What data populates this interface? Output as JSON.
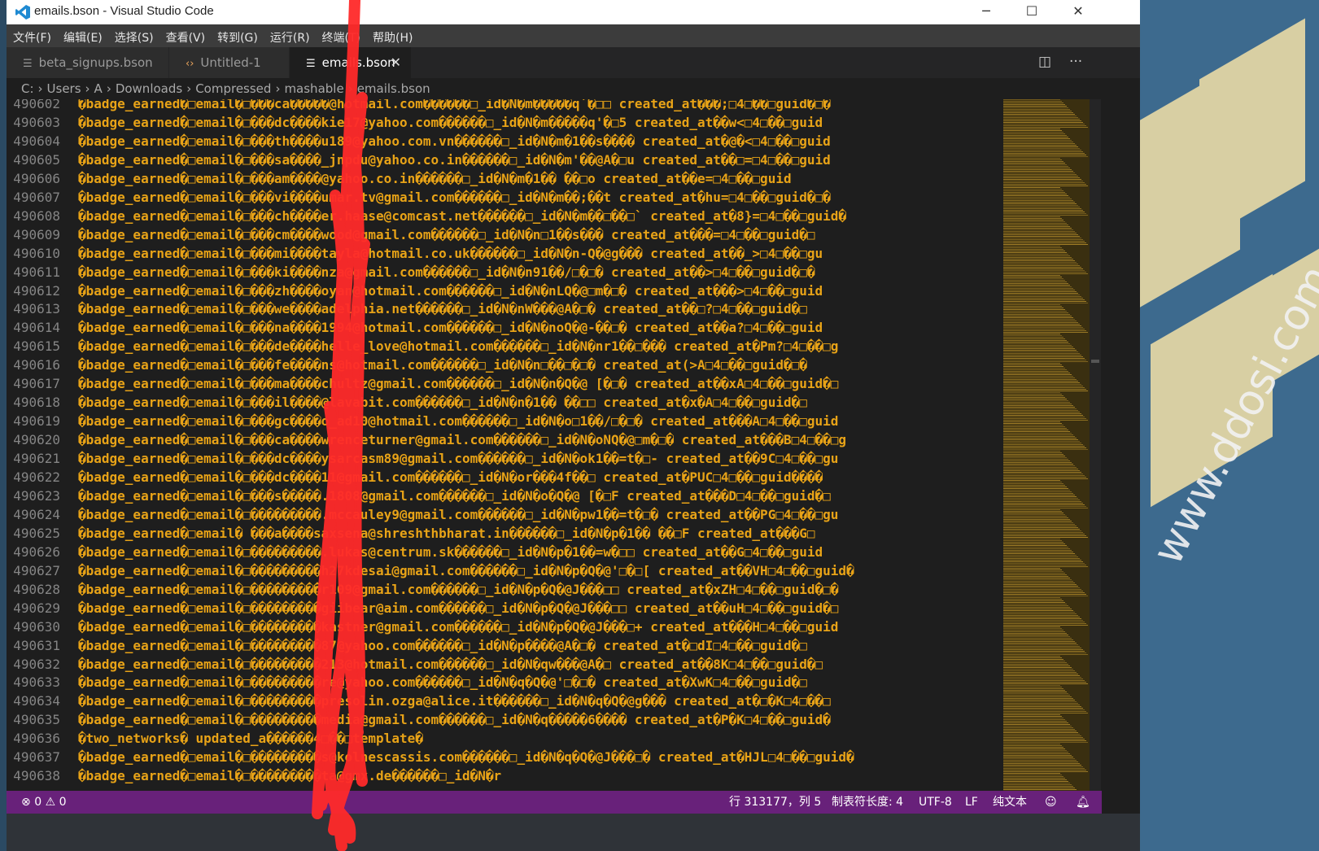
{
  "window": {
    "title": "emails.bson - Visual Studio Code",
    "minimize": "─",
    "maximize": "☐",
    "close": "✕"
  },
  "menu": [
    "文件(F)",
    "编辑(E)",
    "选择(S)",
    "查看(V)",
    "转到(G)",
    "运行(R)",
    "终端(T)",
    "帮助(H)"
  ],
  "tabs": [
    {
      "label": "beta_signups.bson",
      "icon": "lines-icon"
    },
    {
      "label": "Untitled-1",
      "icon": "brackets-icon"
    },
    {
      "label": "emails.bson",
      "icon": "lines-icon"
    }
  ],
  "breadcrumb": [
    "C:",
    "Users",
    "A",
    "Downloads",
    "Compressed",
    "mashable",
    "emails.bson"
  ],
  "lines": [
    {
      "n": "490602",
      "t": "�badge_earned�□email�□���ca�����@hotmail.com������□_id�N�m�����q`�□□   created_at���;□4□��□guid�□�"
    },
    {
      "n": "490603",
      "t": "�badge_earned�□email�□���dc����kie17@yahoo.com������□_id�N�m�����q'�□5    created_at��w<□4□��□guid"
    },
    {
      "n": "490604",
      "t": "�badge_earned�□email�□���th����u189@yahoo.com.vn������□_id�N�m�1��s����   created_at�@�<□4□��□guid"
    },
    {
      "n": "490605",
      "t": "�badge_earned�□email�□���sa����_jnpdu@yahoo.co.in������□_id�N�m'��@A�□u  created_at��□=□4□��□guid"
    },
    {
      "n": "490606",
      "t": "�badge_earned�□email�□���am����@yahoo.co.in������□_id�N�m�1��    ��□o    created_at��e=□4□��□guid"
    },
    {
      "n": "490607",
      "t": "�badge_earned�□email�□���vi����umar.tv@gmail.com������□_id�N�m��;��t created_at�hu=□4□��□guid�□�"
    },
    {
      "n": "490608",
      "t": "�badge_earned�□email�□���ch����er.haase@comcast.net������□_id�N�m��□��□`  created_at�8}=□4□��□guid�"
    },
    {
      "n": "490609",
      "t": "�badge_earned�□email�□���cm����wood@gmail.com������□_id�N�n□1��s���   created_at���=□4□��□guid�□"
    },
    {
      "n": "490610",
      "t": "�badge_earned�□email�□���mi����tayla@hotmail.co.uk������□_id�N�n-Q�@g���    created_at��_>□4□��□gu"
    },
    {
      "n": "490611",
      "t": "�badge_earned�□email�□���ki����nza@gmail.com������□_id�N�n91��/□�□�  created_at��>□4□��□guid�□�"
    },
    {
      "n": "490612",
      "t": "�badge_earned�□email�□���zh����oyan@hotmail.com������□_id�N�nLQ�@□m�□�    created_at���>□4□��□guid"
    },
    {
      "n": "490613",
      "t": "�badge_earned�□email�□���we����adelphia.net������□_id�N�nW���@A�□�    created_at��□?□4□��□guid�□"
    },
    {
      "n": "490614",
      "t": "�badge_earned�□email�□���na����1994@hotmail.com������□_id�N�noQ�@-��□�    created_at��a?□4□��□guid"
    },
    {
      "n": "490615",
      "t": "�badge_earned�□email�□���de����helle_love@hotmail.com������□_id�N�nr1��□���    created_at�Pm?□4□��□g"
    },
    {
      "n": "490616",
      "t": "�badge_earned�□email�□���fe����ns@hotmail.com������□_id�N�n□��□�□�   created_at(>A□4□��□guid�□�"
    },
    {
      "n": "490617",
      "t": "�badge_earned�□email�□���ma����chultz@gmail.com������□_id�N�n�Q�@ [�□� created_at��xA□4□��□guid�□"
    },
    {
      "n": "490618",
      "t": "�badge_earned�□email�□���il����@lavabit.com������□_id�N�n�1�� ��□□    created_at�x�A□4□��□guid�□"
    },
    {
      "n": "490619",
      "t": "�badge_earned�□email�□���gc����o_ad10@hotmail.com������□_id�N�o□1��/□�□�  created_at���A□4□��□guid"
    },
    {
      "n": "490620",
      "t": "�badge_earned�□email�□���ca����wrenceturner@gmail.com������□_id�N�oNQ�@□m�□�  created_at���B□4□��□g"
    },
    {
      "n": "490621",
      "t": "�badge_earned�□email�□���dc����ysarcasm89@gmail.com������□_id�N�ok1��=t�□-    created_at��9C□4□��□gu"
    },
    {
      "n": "490622",
      "t": "�badge_earned�□email�□���dc����11@gmail.com������□_id�N�or���4f��□ created_at�PUC□4□��□guid����"
    },
    {
      "n": "490623",
      "t": "�badge_earned�□email�□���s�����.1808@gmail.com������□_id�N�o�Q�@ [�□F created_at���D□4□��□guid�□"
    },
    {
      "n": "490624",
      "t": "�badge_earned�□email�□���������.mccauley9@gmail.com������□_id�N�pw1��=t�□�    created_at��PG□4□��□gu"
    },
    {
      "n": "490625",
      "t": "�badge_earned�□email� ���a����saxsena@shreshthbharat.in������□_id�N�p�1��    ��□F    created_at���G□"
    },
    {
      "n": "490626",
      "t": "�badge_earned�□email�□���������.lukas@centrum.sk������□_id�N�p�1��=w�□□    created_at��G□4□��□guid"
    },
    {
      "n": "490627",
      "t": "�badge_earned�□email�□���������h27kdesai@gmail.com������□_id�N�p�Q�@'□�□[ created_at��VH□4□��□guid�"
    },
    {
      "n": "490628",
      "t": "�badge_earned�□email�□���������r109@gmail.com������□_id�N�p�Q�@J���□□  created_at�xZH□4□��□guid�□�"
    },
    {
      "n": "490629",
      "t": "�badge_earned�□email�□���������giibear@aim.com������□_id�N�p�Q�@J���□□  created_at��uH□4□��□guid�□"
    },
    {
      "n": "490630",
      "t": "�badge_earned�□email�□���������kastner@gmail.com������□_id�N�p�Q�@J���□+    created_at���H□4□��□guid"
    },
    {
      "n": "490631",
      "t": "�badge_earned�□email�□���������87@yahoo.com������□_id�N�p����@A�□�    created_at�□dI□4□��□guid�□"
    },
    {
      "n": "490632",
      "t": "�badge_earned�□email�□���������213@hotmail.com������□_id�N�qw���@A�□  created_at��8K□4□��□guid�□"
    },
    {
      "n": "490633",
      "t": "�badge_earned�□email�□���������re@yahoo.com������□_id�N�q�Q�@'□�□�    created_at�XwK□4□��□guid�□"
    },
    {
      "n": "490634",
      "t": "�badge_earned�□email�□���������presolin.ozga@alice.it������□_id�N�q�Q�@g���   created_at�□�K□4□��□"
    },
    {
      "n": "490635",
      "t": "�badge_earned�□email�□���������media@gmail.com������□_id�N�q�����6���� created_at�P�K□4□��□guid�"
    },
    {
      "n": "490636",
      "t": "�two_networks�    updated_a������4□��□template�"
    },
    {
      "n": "490637",
      "t": "�badge_earned�□email�□���������s@kolnescassis.com������□_id�N�q�Q�@J���□�   created_at�HJL□4□��□guid�"
    },
    {
      "n": "490638",
      "t": "�badge_earned�□email�□���������ta@gmx.de������□_id�N�r"
    }
  ],
  "status": {
    "errors": "0",
    "warnings": "0",
    "position": "行 313177，列 5",
    "tab_size": "制表符长度: 4",
    "encoding": "UTF-8",
    "eol": "LF",
    "language": "纯文本"
  },
  "watermark": "www.ddosi.com",
  "colors": {
    "status_bar": "#68217a",
    "code_text": "#e8a317",
    "redaction": "#ff2a2a"
  }
}
